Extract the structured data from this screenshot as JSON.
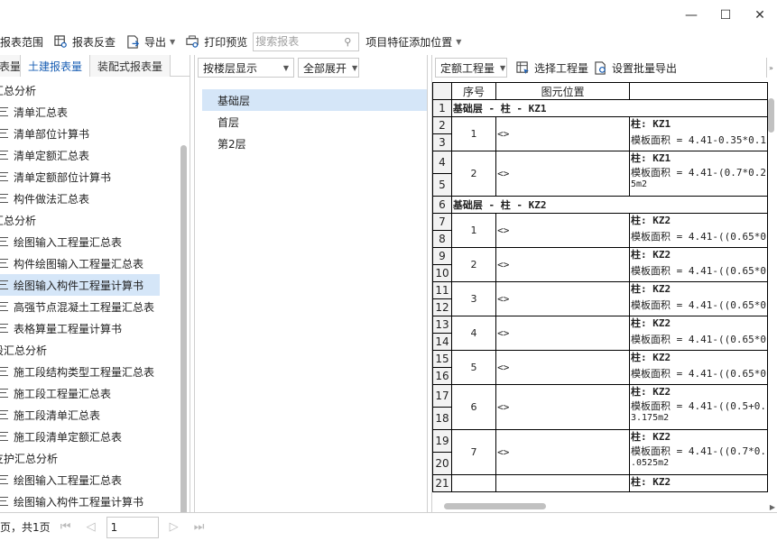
{
  "window": {
    "minimize_glyph": "—",
    "maximize_glyph": "☐",
    "close_glyph": "✕"
  },
  "toolbar": {
    "report_scope": "报表范围",
    "report_check": "报表反查",
    "export": "导出",
    "print_preview": "打印预览",
    "search_placeholder": "搜索报表",
    "item_feature_add_position": "项目特征添加位置"
  },
  "left_tabs": [
    "表量",
    "土建报表量",
    "装配式报表量"
  ],
  "left_tabs_active": 1,
  "tree": [
    {
      "type": "group",
      "label": "汇总分析"
    },
    {
      "type": "leaf",
      "label": "清单汇总表"
    },
    {
      "type": "leaf",
      "label": "清单部位计算书"
    },
    {
      "type": "leaf",
      "label": "清单定额汇总表"
    },
    {
      "type": "leaf",
      "label": "清单定额部位计算书"
    },
    {
      "type": "leaf",
      "label": "构件做法汇总表"
    },
    {
      "type": "group",
      "label": "汇总分析"
    },
    {
      "type": "leaf",
      "label": "绘图输入工程量汇总表"
    },
    {
      "type": "leaf",
      "label": "构件绘图输入工程量汇总表"
    },
    {
      "type": "leaf",
      "label": "绘图输入构件工程量计算书",
      "selected": true
    },
    {
      "type": "leaf",
      "label": "高强节点混凝土工程量汇总表"
    },
    {
      "type": "leaf",
      "label": "表格算量工程量计算书"
    },
    {
      "type": "group",
      "label": "段汇总分析"
    },
    {
      "type": "leaf",
      "label": "施工段结构类型工程量汇总表"
    },
    {
      "type": "leaf",
      "label": "施工段工程量汇总表"
    },
    {
      "type": "leaf",
      "label": "施工段清单汇总表"
    },
    {
      "type": "leaf",
      "label": "施工段清单定额汇总表"
    },
    {
      "type": "group",
      "label": "支护汇总分析"
    },
    {
      "type": "leaf",
      "label": "绘图输入工程量汇总表"
    },
    {
      "type": "leaf",
      "label": "绘图输入构件工程量计算书"
    }
  ],
  "middle": {
    "floor_display": "按楼层显示",
    "expand_all": "全部展开",
    "floors": [
      "基础层",
      "首层",
      "第2层"
    ],
    "selected_floor": 0
  },
  "right": {
    "quota_quantity": "定额工程量",
    "select_quantity": "选择工程量",
    "batch_export": "设置批量导出",
    "more_glyph": "»",
    "headers": {
      "seq": "序号",
      "position": "图元位置",
      "formula": ""
    }
  },
  "grid_rows": [
    {
      "rows": [
        1
      ],
      "section": "基础层 - 柱 - KZ1"
    },
    {
      "rows": [
        2,
        3
      ],
      "seq": "1",
      "position": "<>",
      "lines": [
        "柱: KZ1",
        "模板面积 = 4.41-0.35*0.1"
      ]
    },
    {
      "rows": [
        4,
        5
      ],
      "seq": "2",
      "position": "<>",
      "lines": [
        "柱: KZ1",
        "模板面积 = 4.41-(0.7*0.2",
        "5m2"
      ]
    },
    {
      "rows": [
        6
      ],
      "section": "基础层 - 柱 - KZ2"
    },
    {
      "rows": [
        7,
        8
      ],
      "seq": "1",
      "position": "<>",
      "lines": [
        "柱: KZ2",
        "模板面积 = 4.41-((0.65*0"
      ]
    },
    {
      "rows": [
        9,
        10
      ],
      "seq": "2",
      "position": "<>",
      "lines": [
        "柱: KZ2",
        "模板面积 = 4.41-((0.65*0"
      ]
    },
    {
      "rows": [
        11,
        12
      ],
      "seq": "3",
      "position": "<>",
      "lines": [
        "柱: KZ2",
        "模板面积 = 4.41-((0.65*0"
      ]
    },
    {
      "rows": [
        13,
        14
      ],
      "seq": "4",
      "position": "<>",
      "lines": [
        "柱: KZ2",
        "模板面积 = 4.41-((0.65*0"
      ]
    },
    {
      "rows": [
        15,
        16
      ],
      "seq": "5",
      "position": "<>",
      "lines": [
        "柱: KZ2",
        "模板面积 = 4.41-((0.65*0"
      ]
    },
    {
      "rows": [
        17,
        18
      ],
      "seq": "6",
      "position": "<>",
      "lines": [
        "柱: KZ2",
        "模板面积 = 4.41-((0.5+0.",
        "3.175m2"
      ]
    },
    {
      "rows": [
        19,
        20
      ],
      "seq": "7",
      "position": "<>",
      "lines": [
        "柱: KZ2",
        "模板面积 = 4.41-((0.7*0.",
        ".0525m2"
      ]
    },
    {
      "rows": [
        21
      ],
      "seq": "",
      "position": "",
      "lines": [
        "柱: KZ2"
      ]
    }
  ],
  "pager": {
    "page_info": "页，共1页",
    "current_page": "1"
  }
}
